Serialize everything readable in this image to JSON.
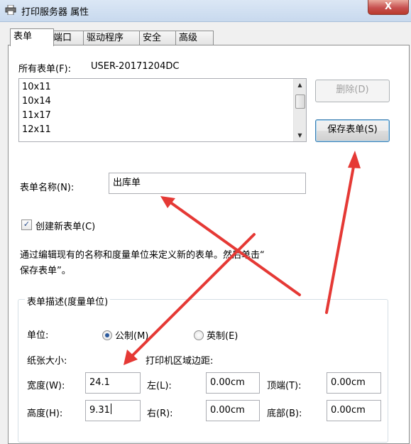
{
  "window": {
    "title": "打印服务器 属性",
    "close_glyph": "X"
  },
  "tabs": [
    {
      "label": "表单",
      "active": true
    },
    {
      "label": "端口"
    },
    {
      "label": "驱动程序"
    },
    {
      "label": "安全"
    },
    {
      "label": "高级"
    }
  ],
  "forms": {
    "label": "所有表单(F):",
    "server": "USER-20171204DC",
    "items": [
      "10x11",
      "10x14",
      "11x17",
      "12x11"
    ],
    "delete_button": "删除(D)",
    "save_button": "保存表单(S)"
  },
  "form_name": {
    "label": "表单名称(N):",
    "value": "出库单"
  },
  "create_new": {
    "label": "创建新表单(C)",
    "checked": true
  },
  "instructions": {
    "line1": "通过编辑现有的名称和度量单位来定义新的表单。然后单击“",
    "line2": "保存表单”。"
  },
  "description": {
    "group_label": "表单描述(度量单位)",
    "unit_label": "单位:",
    "metric_label": "公制(M)",
    "english_label": "英制(E)",
    "selected_unit": "metric",
    "paper_size_label": "纸张大小:",
    "margin_label": "打印机区域边距:",
    "width_label": "宽度(W):",
    "width_value": "24.1",
    "height_label": "高度(H):",
    "height_value": "9.31",
    "left_label": "左(L):",
    "left_value": "0.00cm",
    "right_label": "右(R):",
    "right_value": "0.00cm",
    "top_label": "顶端(T):",
    "top_value": "0.00cm",
    "bottom_label": "底部(B):",
    "bottom_value": "0.00cm"
  },
  "annotation_color": "#e53935"
}
